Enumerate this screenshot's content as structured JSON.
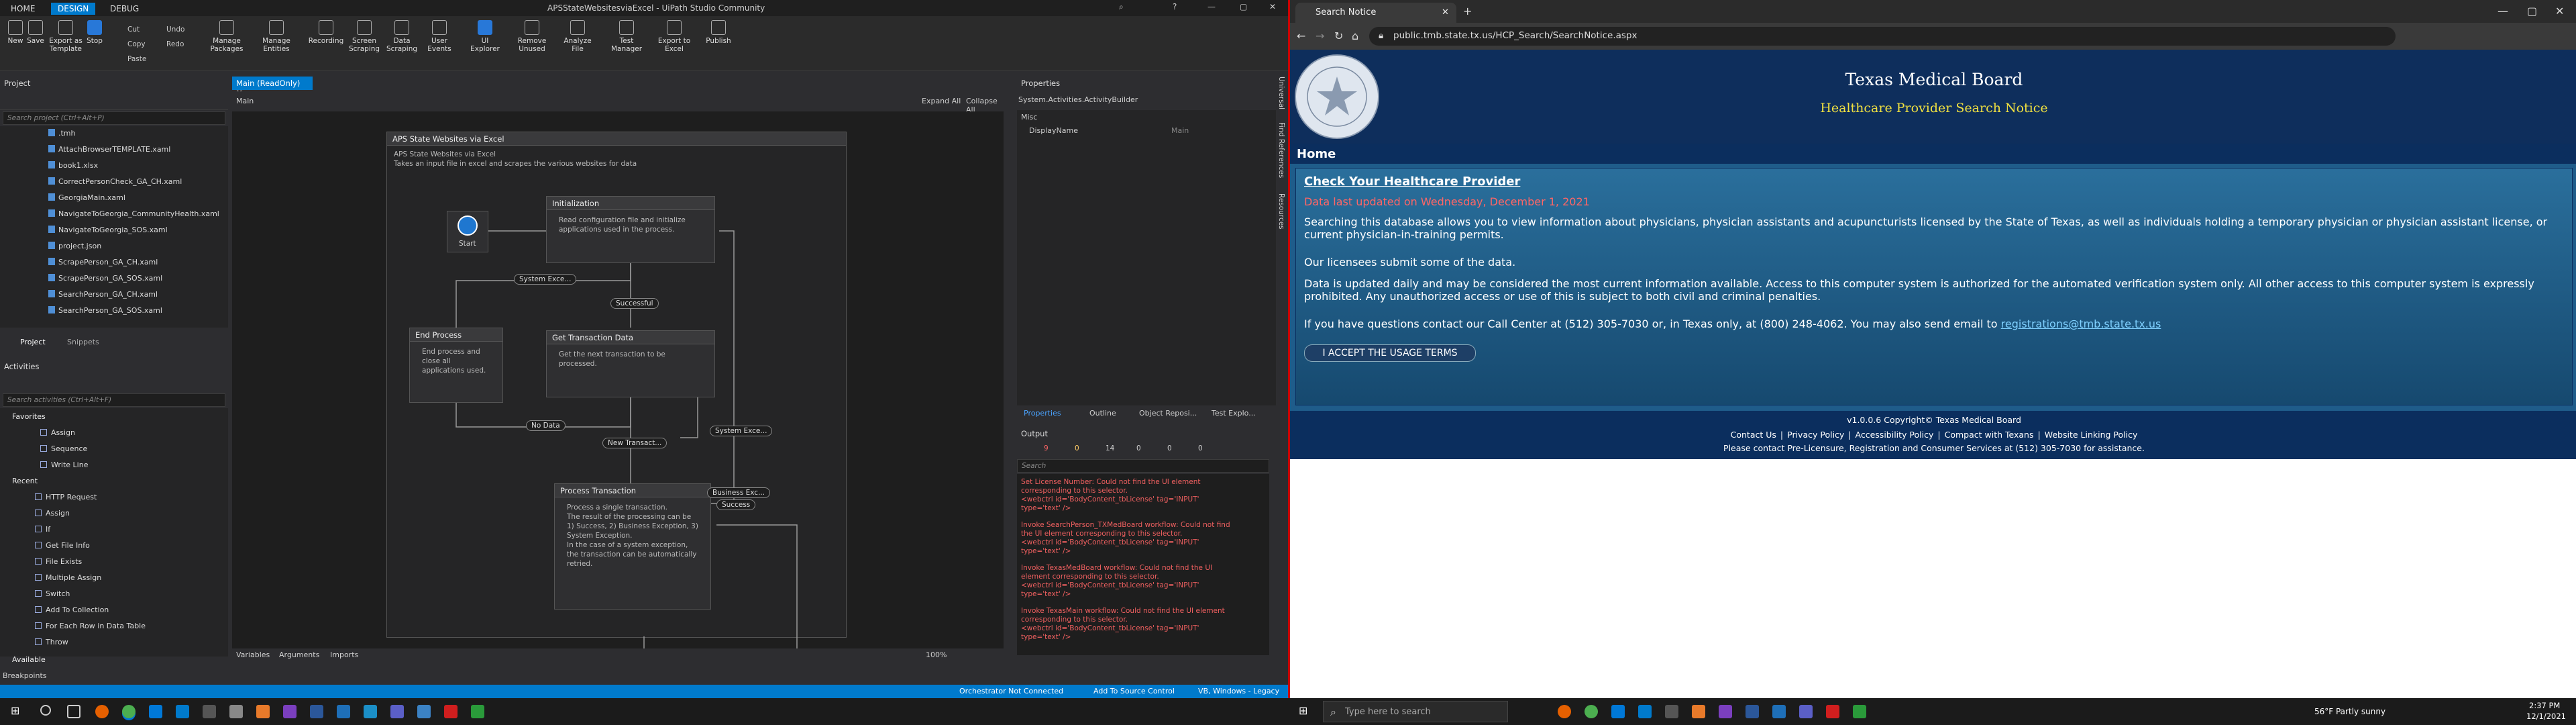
{
  "uipath": {
    "title": "APSStateWebsitesviaExcel - UiPath Studio Community",
    "tabs": [
      "HOME",
      "DESIGN",
      "DEBUG"
    ],
    "ribbon": {
      "new": "New",
      "save": "Save",
      "export_template": "Export as Template",
      "stop": "Stop",
      "cut": "Cut",
      "copy": "Copy",
      "paste": "Paste",
      "undo": "Undo",
      "redo": "Redo",
      "manage_packages": "Manage Packages",
      "manage_entities": "Manage Entities",
      "recording": "Recording",
      "screen_scraping": "Screen Scraping",
      "data_scraping": "Data Scraping",
      "user_events": "User Events",
      "ui_explorer": "UI Explorer",
      "remove_unused": "Remove Unused",
      "analyze_file": "Analyze File",
      "test_manager": "Test Manager",
      "export_excel": "Export to Excel",
      "publish": "Publish"
    },
    "project": {
      "header": "Project",
      "search": "Search project (Ctrl+Alt+P)",
      "files": [
        ".tmh",
        "AttachBrowserTEMPLATE.xaml",
        "book1.xlsx",
        "CorrectPersonCheck_GA_CH.xaml",
        "GeorgiaMain.xaml",
        "NavigateToGeorgia_CommunityHealth.xaml",
        "NavigateToGeorgia_SOS.xaml",
        "project.json",
        "ScrapePerson_GA_CH.xaml",
        "ScrapePerson_GA_SOS.xaml",
        "SearchPerson_GA_CH.xaml",
        "SearchPerson_GA_SOS.xaml"
      ],
      "tab_project": "Project",
      "tab_snippets": "Snippets"
    },
    "activities": {
      "header": "Activities",
      "search": "Search activities (Ctrl+Alt+F)",
      "favorites": "Favorites",
      "fav_items": [
        "Assign",
        "Sequence",
        "Write Line"
      ],
      "recent": "Recent",
      "recent_items": [
        "HTTP Request",
        "Assign",
        "If",
        "Get File Info",
        "File Exists",
        "Multiple Assign",
        "Switch",
        "Add To Collection",
        "For Each Row in Data Table",
        "Throw"
      ],
      "available": "Available"
    },
    "doc_tab": "Main (ReadOnly)",
    "breadcrumb": "Main",
    "expand_all": "Expand All",
    "collapse_all": "Collapse All",
    "workflow": {
      "title": "APS State Websites via Excel",
      "desc": "APS State Websites via Excel\nTakes an input file in excel and scrapes the various websites for data",
      "start": "Start",
      "init_title": "Initialization",
      "init_body": "Read configuration file and initialize applications used in the process.",
      "end_title": "End Process",
      "end_body": "End process and close all applications used.",
      "get_title": "Get Transaction Data",
      "get_body": "Get the next transaction to be processed.",
      "proc_title": "Process Transaction",
      "proc_body": "Process a single transaction.\nThe result of the processing can be 1) Success, 2) Business Exception, 3) System Exception.\nIn the case of a system exception, the transaction can be automatically retried.",
      "l_sysexc1": "System Exce...",
      "l_success1": "Successful",
      "l_nodata": "No Data",
      "l_newtrans": "New Transact...",
      "l_sysexc2": "System Exce...",
      "l_busexc": "Business Exc...",
      "l_success2": "Success"
    },
    "bottom_tabs": [
      "Variables",
      "Arguments",
      "Imports"
    ],
    "zoom": "100%",
    "properties": {
      "header": "Properties",
      "type": "System.Activities.ActivityBuilder",
      "group": "Misc",
      "prop": "DisplayName",
      "value": "Main"
    },
    "right_tabs": [
      "Properties",
      "Outline",
      "Object Reposi...",
      "Test Explo..."
    ],
    "output": {
      "header": "Output",
      "search": "Search",
      "counts": [
        "9",
        "0",
        "14",
        "0",
        "0",
        "0"
      ],
      "errors": [
        "Set License Number: Could not find the UI element\ncorresponding to this selector.\n<webctrl id='BodyContent_tbLicense' tag='INPUT'\ntype='text' />",
        "Invoke SearchPerson_TXMedBoard workflow: Could not find\nthe UI element corresponding to this selector.\n<webctrl id='BodyContent_tbLicense' tag='INPUT'\ntype='text' />",
        "Invoke TexasMedBoard workflow: Could not find the UI\nelement corresponding to this selector.\n<webctrl id='BodyContent_tbLicense' tag='INPUT'\ntype='text' />",
        "Invoke TexasMain workflow: Could not find the UI element\ncorresponding to this selector.\n<webctrl id='BodyContent_tbLicense' tag='INPUT'\ntype='text' />"
      ]
    },
    "side_tabs": [
      "Universal",
      "Find References",
      "Resources"
    ],
    "breakpoints": "Breakpoints",
    "status": {
      "orchestrator": "Orchestrator Not Connected",
      "source": "Add To Source Control",
      "vb": "VB, Windows - Legacy"
    }
  },
  "chrome": {
    "tab_title": "Search Notice",
    "url": "public.tmb.state.tx.us/HCP_Search/SearchNotice.aspx",
    "site_title": "Texas Medical Board",
    "site_subtitle": "Healthcare Provider Search Notice",
    "nav_home": "Home",
    "heading": "Check Your Healthcare Provider",
    "updated": "Data last updated on Wednesday, December 1, 2021",
    "p1": "Searching this database allows you to view information about physicians, physician assistants and acupuncturists licensed by the State of Texas, as well as individuals holding a temporary physician or physician assistant license, or current physician-in-training permits.",
    "p2": "Our licensees submit some of the data.",
    "p3": "Data is updated daily and may be considered the most current information available. Access to this computer system is authorized for the automated verification system only. All other access to this computer system is expressly prohibited. Any unauthorized access or use of this is subject to both civil and criminal penalties.",
    "p4": "If you have questions contact our Call Center at (512) 305-7030 or, in Texas only, at (800) 248-4062. You may also send email to",
    "email": "registrations@tmb.state.tx.us",
    "accept": "I ACCEPT THE USAGE TERMS",
    "footer_copy": "v1.0.0.6 Copyright© Texas Medical Board",
    "footer_links": [
      "Contact Us",
      "Privacy Policy",
      "Accessibility Policy",
      "Compact with Texans",
      "Website Linking Policy"
    ],
    "footer_contact": "Please contact Pre-Licensure, Registration and Consumer Services at (512) 305-7030 for assistance.",
    "seal_text": "THE STATE OF TEXAS"
  },
  "taskbar": {
    "search_placeholder": "Type here to search",
    "weather": "56°F  Partly sunny",
    "time": "2:37 PM",
    "date": "12/1/2021"
  }
}
